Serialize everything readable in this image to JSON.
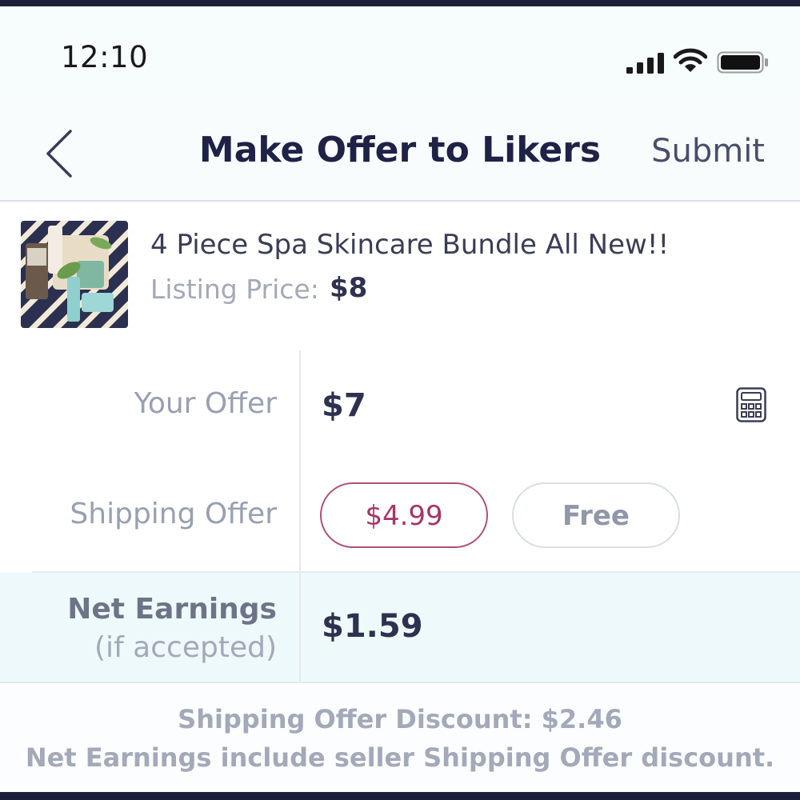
{
  "status_bar": {
    "time": "12:10",
    "icons": [
      "signal-icon",
      "wifi-icon",
      "battery-icon"
    ]
  },
  "nav": {
    "back_icon": "chevron-left-icon",
    "title": "Make Offer to Likers",
    "submit_label": "Submit"
  },
  "listing": {
    "title": "4 Piece Spa Skincare Bundle All New!!",
    "price_label": "Listing Price:",
    "price_value": "$8"
  },
  "offer": {
    "label": "Your Offer",
    "value": "$7",
    "calculator_icon": "calculator-icon"
  },
  "shipping": {
    "label": "Shipping Offer",
    "options": [
      {
        "label": "$4.99",
        "selected": true
      },
      {
        "label": "Free",
        "selected": false
      }
    ]
  },
  "net": {
    "label": "Net Earnings",
    "sublabel": "(if accepted)",
    "value": "$1.59"
  },
  "footer": {
    "discount_line": "Shipping Offer Discount: $2.46",
    "note_line": "Net Earnings include seller Shipping Offer discount."
  },
  "colors": {
    "accent": "#a53468",
    "title": "#1f2146",
    "muted": "#98a0b1",
    "highlight_row": "#eef9fb"
  }
}
